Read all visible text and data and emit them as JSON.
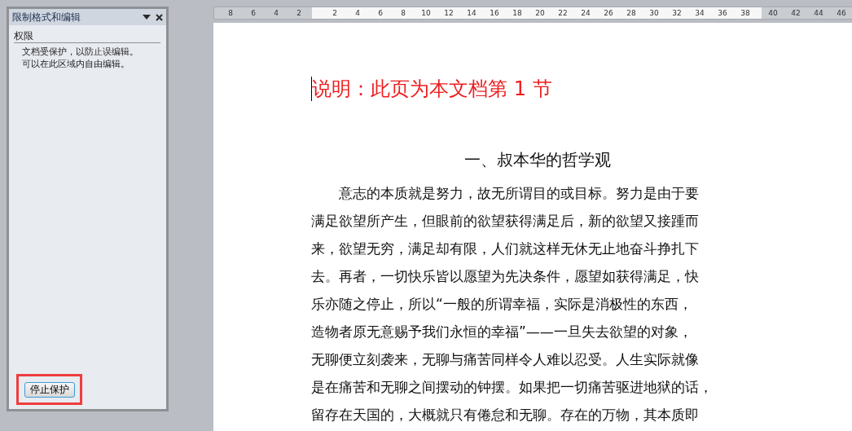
{
  "pane": {
    "title": "限制格式和编辑",
    "section": "权限",
    "messages": [
      "文档受保护，以防止误编辑。",
      "可以在此区域内自由编辑。"
    ],
    "button": {
      "label": "停止保护",
      "highlighted": true
    }
  },
  "ruler": {
    "left_labels": [
      "8",
      "6",
      "4",
      "2"
    ],
    "right_labels": [
      "2",
      "4",
      "6",
      "8",
      "10",
      "12",
      "14",
      "16",
      "18",
      "20",
      "22",
      "24",
      "26",
      "28",
      "30",
      "32",
      "34",
      "36",
      "38",
      "40",
      "42",
      "44",
      "46"
    ]
  },
  "document": {
    "note": "说明：此页为本文档第 1 节",
    "heading": "一、叔本华的哲学观",
    "paragraph": [
      "意志的本质就是努力，故无所谓目的或目标。努力是由于要",
      "满足欲望所产生，但眼前的欲望获得满足后，新的欲望又接踵而",
      "来，欲望无穷，满足却有限，人们就这样无休无止地奋斗挣扎下",
      "去。再者，一切快乐皆以愿望为先决条件，愿望如获得满足，快",
      "乐亦随之停止，所以“一般的所谓幸福，实际是消极性的东西，",
      "造物者原无意赐予我们永恒的幸福”——一旦失去欲望的对象，",
      "无聊便立刻袭来，无聊与痛苦同样令人难以忍受。人生实际就像",
      "是在痛苦和无聊之间摆动的钟摆。如果把一切痛苦驱进地狱的话，",
      "留存在天国的，大概就只有倦怠和无聊。存在的万物，其本质即"
    ]
  }
}
